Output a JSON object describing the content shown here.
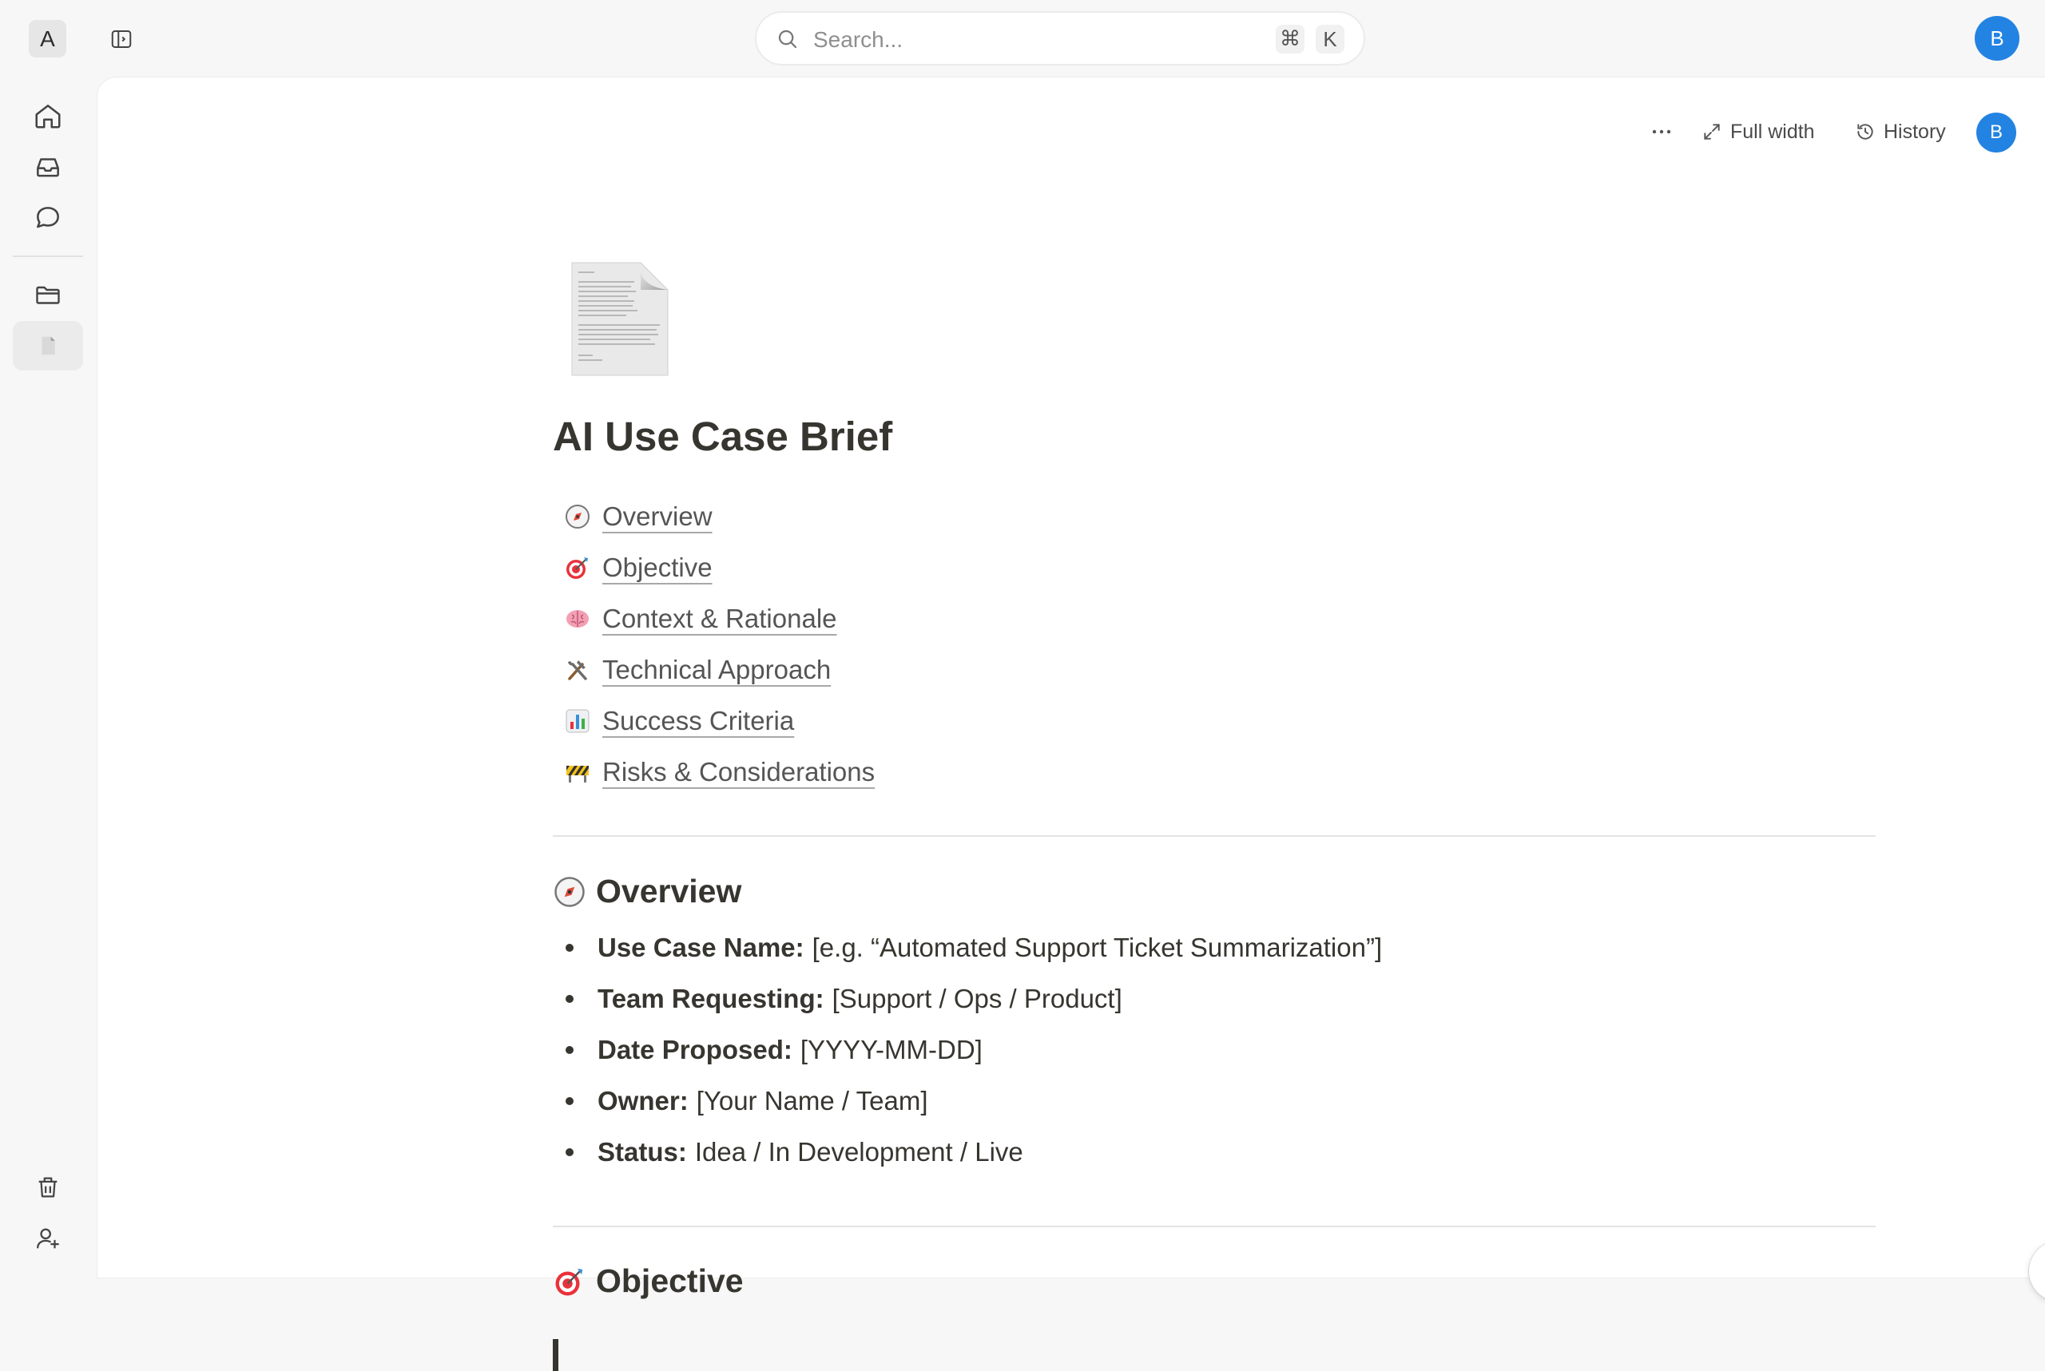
{
  "workspace": {
    "initial": "A"
  },
  "search": {
    "placeholder": "Search...",
    "shortcut_cmd": "⌘",
    "shortcut_key": "K"
  },
  "user": {
    "initial": "B"
  },
  "page_actions": {
    "full_width_label": "Full width",
    "history_label": "History"
  },
  "page": {
    "title": "AI Use Case Brief",
    "toc": [
      {
        "icon": "compass-icon",
        "label": "Overview"
      },
      {
        "icon": "target-icon",
        "label": "Objective"
      },
      {
        "icon": "brain-icon",
        "label": "Context & Rationale"
      },
      {
        "icon": "tools-icon",
        "label": "Technical Approach"
      },
      {
        "icon": "bar-chart-icon",
        "label": "Success Criteria"
      },
      {
        "icon": "construction-barrier-icon",
        "label": "Risks & Considerations"
      }
    ],
    "sections": {
      "overview": {
        "heading": "Overview",
        "items": [
          {
            "label": "Use Case Name:",
            "value": "[e.g. “Automated Support Ticket Summarization”]"
          },
          {
            "label": "Team Requesting:",
            "value": "[Support / Ops / Product]"
          },
          {
            "label": "Date Proposed:",
            "value": "[YYYY-MM-DD]"
          },
          {
            "label": "Owner:",
            "value": "[Your Name / Team]"
          },
          {
            "label": "Status:",
            "value": "Idea / In Development / Live"
          }
        ]
      },
      "objective": {
        "heading": "Objective"
      }
    }
  },
  "colors": {
    "accent": "#2383e2",
    "text": "#37352f",
    "background": "#f7f7f7"
  }
}
